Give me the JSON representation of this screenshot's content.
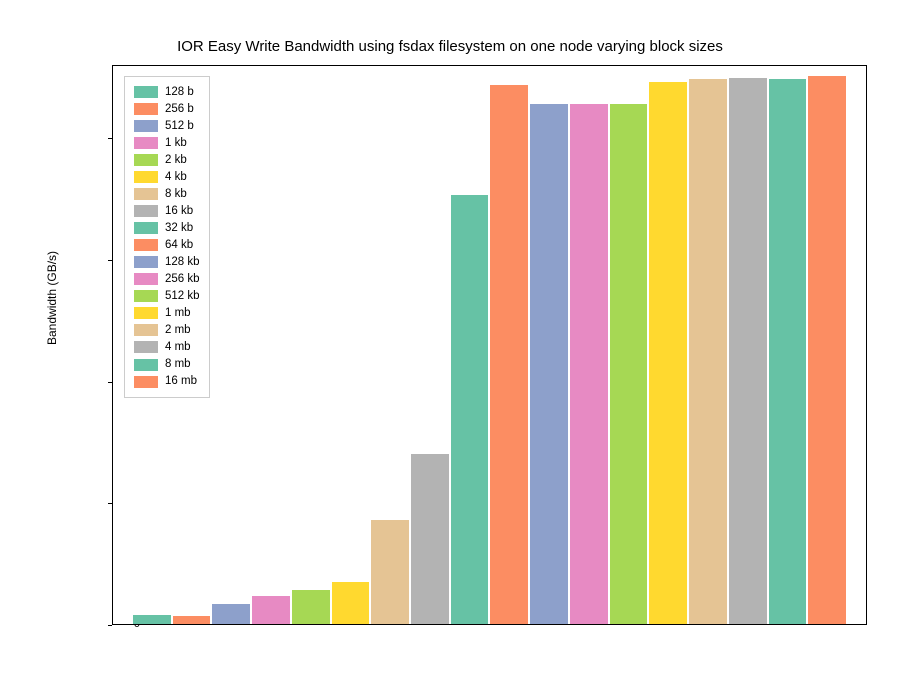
{
  "chart_data": {
    "type": "bar",
    "title": "IOR Easy Write Bandwidth using fsdax filesystem on one node varying block sizes",
    "xlabel": "",
    "ylabel": "Bandwidth (GB/s)",
    "ylim": [
      0,
      9.2
    ],
    "yticks": [
      0,
      2,
      4,
      6,
      8
    ],
    "categories": [
      "128 b",
      "256 b",
      "512 b",
      "1 kb",
      "2 kb",
      "4 kb",
      "8 kb",
      "16 kb",
      "32 kb",
      "64 kb",
      "128 kb",
      "256 kb",
      "512 kb",
      "1 mb",
      "2 mb",
      "4 mb",
      "8 mb",
      "16 mb"
    ],
    "values": [
      0.15,
      0.13,
      0.33,
      0.47,
      0.56,
      0.7,
      1.72,
      2.8,
      7.08,
      8.88,
      8.58,
      8.57,
      8.58,
      8.93,
      8.98,
      9.0,
      8.98,
      9.03
    ],
    "colors": [
      "#66c2a5",
      "#fc8d62",
      "#8da0cb",
      "#e78ac3",
      "#a6d854",
      "#ffd92f",
      "#e5c494",
      "#b3b3b3",
      "#66c2a5",
      "#fc8d62",
      "#8da0cb",
      "#e78ac3",
      "#a6d854",
      "#ffd92f",
      "#e5c494",
      "#b3b3b3",
      "#66c2a5",
      "#fc8d62"
    ]
  }
}
